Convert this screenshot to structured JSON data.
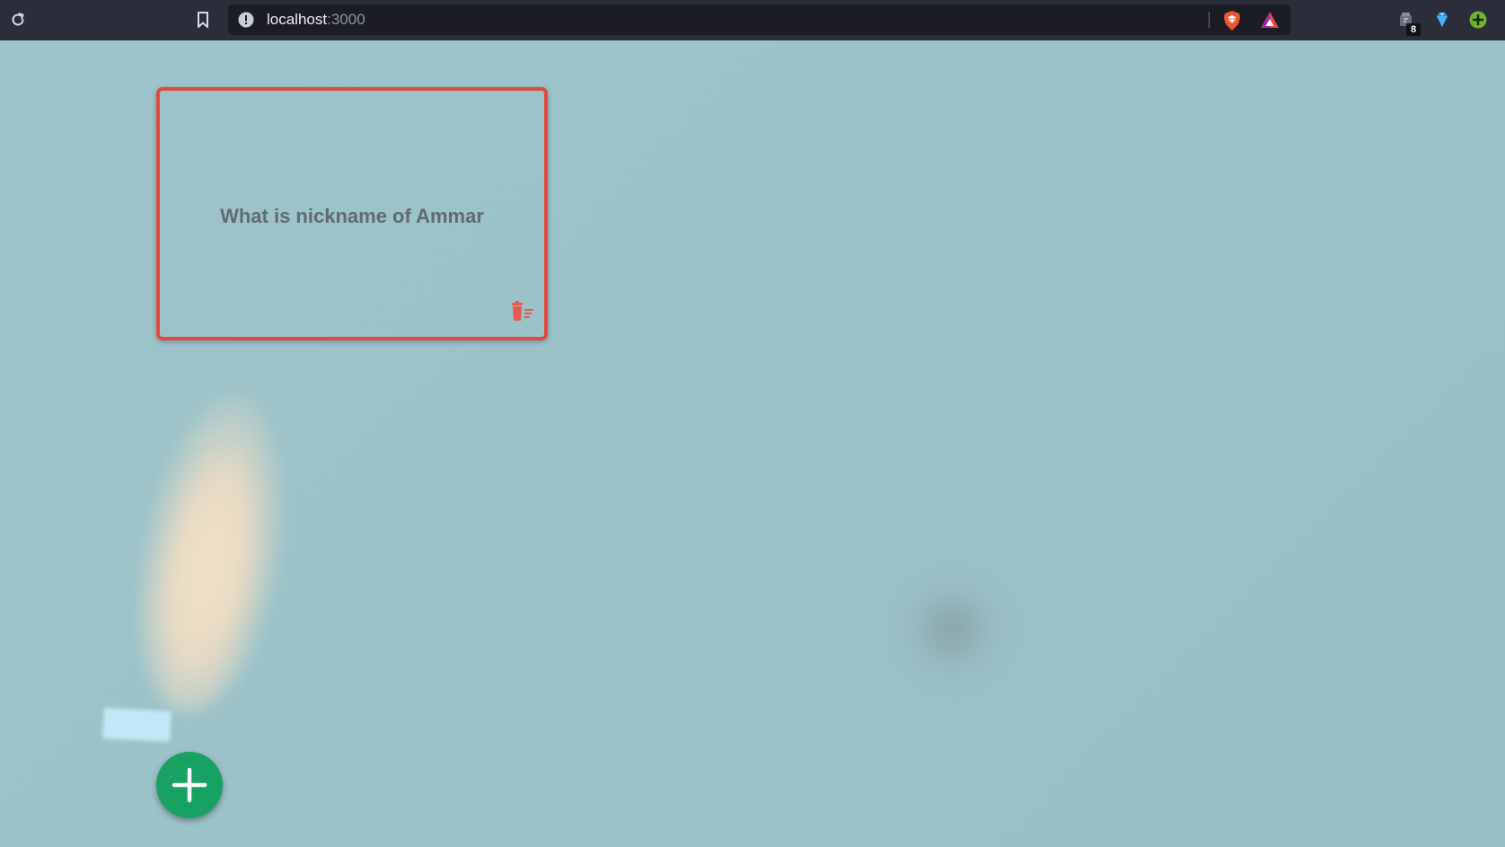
{
  "browser": {
    "reload_icon": "reload-icon",
    "bookmark_icon": "bookmark-icon",
    "address_bar": {
      "site_info_icon": "info-warning-icon",
      "host": "localhost",
      "port": ":3000"
    },
    "toolbar_icons": [
      "brave-shield-icon",
      "brave-rewards-icon"
    ],
    "extensions": [
      {
        "icon": "extension-icon",
        "badge": "8"
      },
      {
        "icon": "gem-icon"
      },
      {
        "icon": "plus-circle-icon"
      }
    ]
  },
  "page": {
    "cards": [
      {
        "question": "What is nickname of Ammar",
        "delete_icon": "trash-icon"
      }
    ],
    "add_button_icon": "plus-icon",
    "colors": {
      "background": "#9cc2c9",
      "card_border": "#e04a3e",
      "card_text": "#616b6e",
      "delete_icon": "#e45a50",
      "fab": "#17a263"
    }
  }
}
